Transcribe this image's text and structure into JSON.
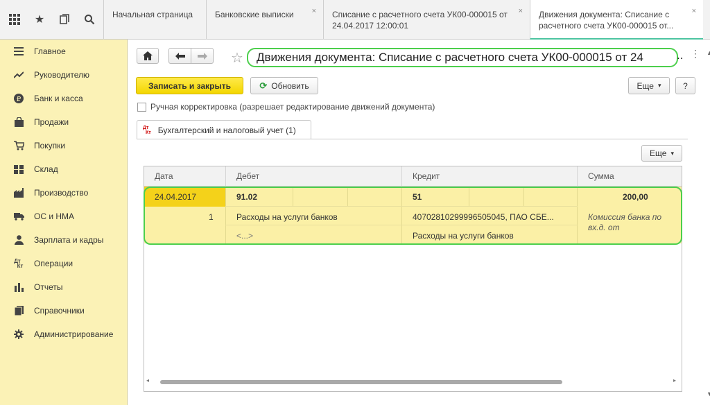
{
  "topbar": {
    "icons": [
      "apps-grid-icon",
      "star-icon",
      "history-icon",
      "search-icon"
    ],
    "tabs": [
      {
        "label": "Начальная страница"
      },
      {
        "label": "Банковские выписки"
      },
      {
        "label": "Списание с расчетного счета УК00-000015 от 24.04.2017 12:00:01"
      },
      {
        "label": "Движения документа: Списание с расчетного счета УК00-000015 от..."
      }
    ],
    "close_glyph": "×"
  },
  "sidebar": {
    "items": [
      {
        "label": "Главное",
        "icon": "menu-icon"
      },
      {
        "label": "Руководителю",
        "icon": "trend-icon"
      },
      {
        "label": "Банк и касса",
        "icon": "ruble-icon"
      },
      {
        "label": "Продажи",
        "icon": "bag-icon"
      },
      {
        "label": "Покупки",
        "icon": "cart-icon"
      },
      {
        "label": "Склад",
        "icon": "warehouse-icon"
      },
      {
        "label": "Производство",
        "icon": "factory-icon"
      },
      {
        "label": "ОС и НМА",
        "icon": "truck-icon"
      },
      {
        "label": "Зарплата и кадры",
        "icon": "person-icon"
      },
      {
        "label": "Операции",
        "icon": "dt-kt-icon"
      },
      {
        "label": "Отчеты",
        "icon": "bar-chart-icon"
      },
      {
        "label": "Справочники",
        "icon": "books-icon"
      },
      {
        "label": "Администрирование",
        "icon": "gear-icon"
      }
    ]
  },
  "main": {
    "title": "Движения документа: Списание с расчетного счета УК00-000015 от 24",
    "title_ellipsis": "..",
    "buttons": {
      "save_close": "Записать и закрыть",
      "refresh": "Обновить",
      "more": "Еще",
      "more_arrow": "▾",
      "help": "?"
    },
    "manual_checkbox": {
      "label": "Ручная корректировка (разрешает редактирование движений документа)",
      "checked": false
    },
    "subtab": {
      "label": "Бухгалтерский и налоговый учет (1)",
      "icon_top": "Дт",
      "icon_bottom": "Кт"
    },
    "table_more": "Еще",
    "table": {
      "headers": [
        "Дата",
        "Дебет",
        "Кредит",
        "Сумма"
      ],
      "row": {
        "date": "24.04.2017",
        "line_no": "1",
        "debit_account": "91.02",
        "debit_sub1": "Расходы на услуги банков",
        "debit_sub2": "<...>",
        "credit_account": "51",
        "credit_sub1": "40702810299996505045, ПАО СБЕ...",
        "credit_sub2": "Расходы на услуги банков",
        "amount": "200,00",
        "comment_line1": "Комиссия банка по",
        "comment_line2": "вх.д.  от"
      }
    }
  },
  "colors": {
    "sidebar_bg": "#fbf2b6",
    "primary_button": "#f3d600",
    "row_highlight": "#fbf0a6",
    "selected_cell": "#f4d21a",
    "annotation_green": "#4ccf4c"
  }
}
